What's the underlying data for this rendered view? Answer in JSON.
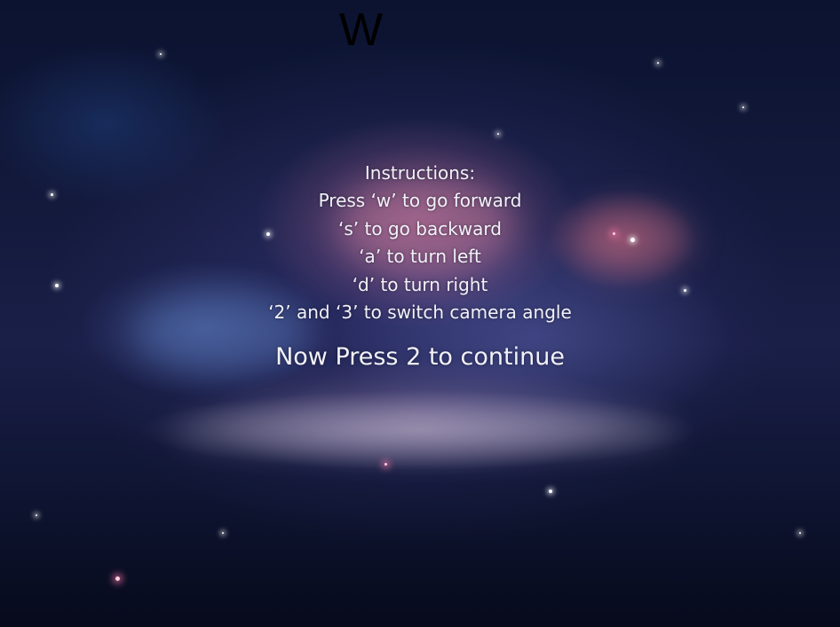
{
  "title_letter": "W",
  "instructions": {
    "heading": "Instructions:",
    "lines": [
      "Press ‘w’ to go forward",
      "‘s’ to go backward",
      "‘a’ to turn left",
      "‘d’ to turn right",
      "‘2’ and ‘3’ to switch camera angle"
    ]
  },
  "continue_prompt": "Now Press 2 to continue",
  "colors": {
    "text": "#f2f2f8",
    "title_letter": "#000000",
    "background": "#141a3d"
  }
}
